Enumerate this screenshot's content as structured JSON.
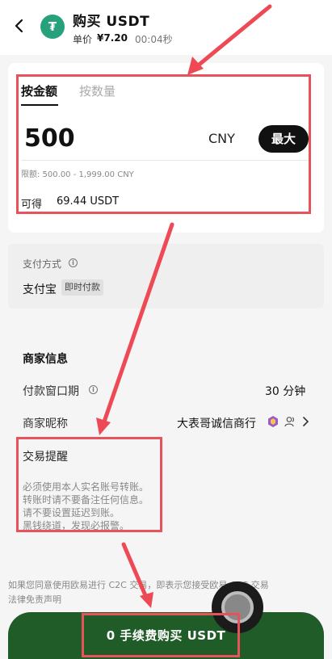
{
  "header": {
    "title": "购买 USDT",
    "price_label": "单价",
    "price": "¥7.20",
    "timer": "00:04秒",
    "logo_glyph": "₮"
  },
  "tabs": [
    {
      "label": "按金额"
    },
    {
      "label": "按数量"
    }
  ],
  "amount_input": {
    "value": "500",
    "currency": "CNY",
    "max_label": "最大"
  },
  "limit_text": "限额: 500.00 - 1,999.00 CNY",
  "receive": {
    "label": "可得",
    "value": "69.44 USDT"
  },
  "payment": {
    "label": "支付方式",
    "method": "支付宝",
    "badge": "即时付款"
  },
  "merchant": {
    "title": "商家信息",
    "window_label": "付款窗口期",
    "window_value": "30 分钟",
    "nickname_label": "商家昵称",
    "nickname_value": "大表哥诚信商行"
  },
  "reminder": {
    "title": "交易提醒",
    "lines": [
      "必须使用本人实名账号转账。",
      "转账时请不要备注任何信息。",
      "请不要设置延迟到账。",
      "黑钱绕道，发现必报警。"
    ]
  },
  "disclaimer": {
    "line1": "如果您同意使用欧易进行 C2C 交易，即表示您接受欧易 C2C 交易",
    "line2": "法律免责声明"
  },
  "buy_button": {
    "label": "0 手续费购买 USDT"
  },
  "colors": {
    "accent": "#1f5c28",
    "highlight": "#e8525a",
    "tether": "#26a17b"
  },
  "icons": [
    "back-arrow-icon",
    "tether-logo-icon",
    "info-icon",
    "merchant-badge-icon",
    "person-icon",
    "chevron-right-icon",
    "floating-ball-icon"
  ]
}
